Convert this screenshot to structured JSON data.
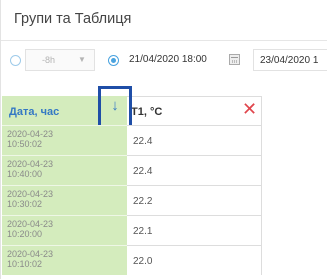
{
  "title": "Групи та Таблиця",
  "filters": {
    "period_value": "-8h",
    "period_arrow": "▼",
    "date_from": "21/04/2020 18:00",
    "date_to": "23/04/2020 1"
  },
  "table": {
    "date_header": "Дата, час",
    "value_header": "T1, °C",
    "close_symbol": "✕",
    "sort_symbol": "↓",
    "rows": [
      {
        "date": "2020-04-23",
        "time": "10:50:02",
        "value": "22.4"
      },
      {
        "date": "2020-04-23",
        "time": "10:40:00",
        "value": "22.4"
      },
      {
        "date": "2020-04-23",
        "time": "10:30:02",
        "value": "22.2"
      },
      {
        "date": "2020-04-23",
        "time": "10:20:00",
        "value": "22.1"
      },
      {
        "date": "2020-04-23",
        "time": "10:10:02",
        "value": "22.0"
      }
    ]
  },
  "colors": {
    "date_column_bg": "#d4ecbd",
    "header_link": "#3478c4",
    "close_red": "#e0454c",
    "highlight_box": "#1f4ea7"
  },
  "icons": {
    "calendar": "calendar-icon",
    "close": "close-icon",
    "sort": "sort-down-icon"
  }
}
